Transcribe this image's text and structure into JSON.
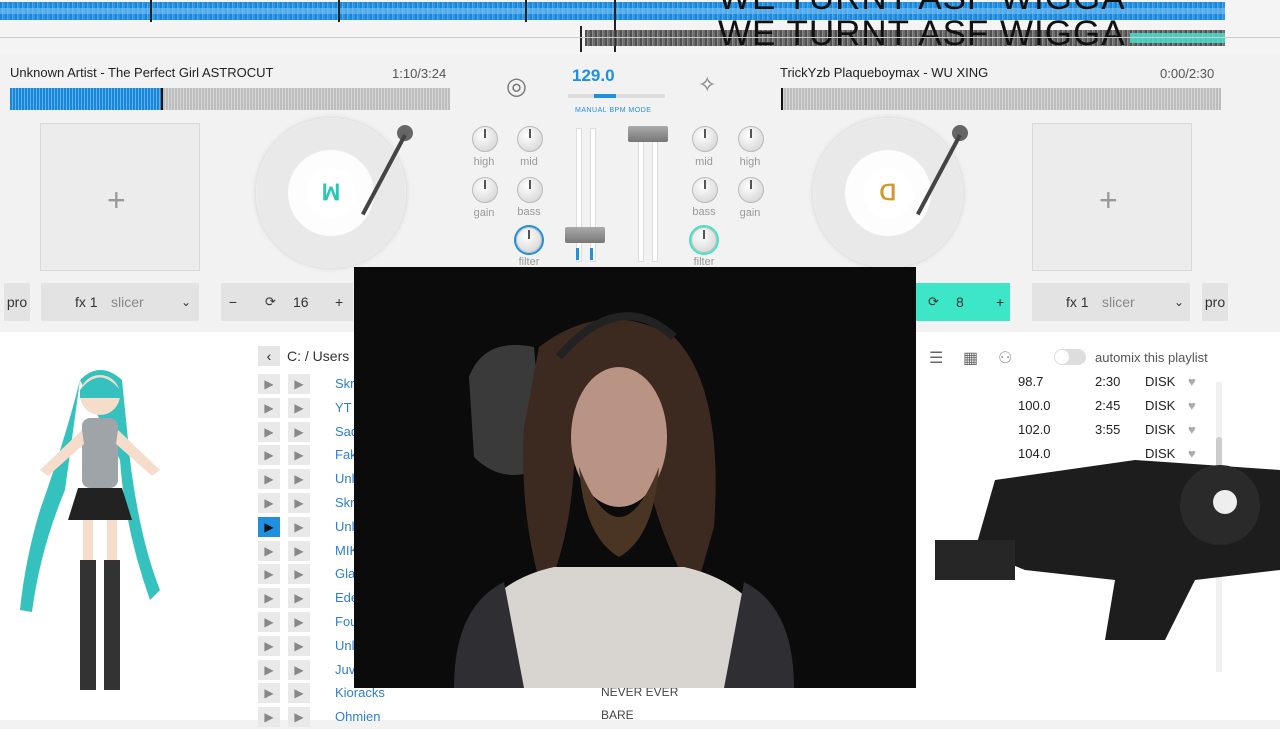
{
  "overview": {
    "overlay_line1": "WE TURNT ASF WIGGA",
    "overlay_line2": "WE TURNT ASF WIGGA"
  },
  "deck_left": {
    "title": "Unknown Artist - The Perfect Girl ASTROCUT",
    "time": "1:10/3:24",
    "pro": "pro",
    "fx": "fx 1",
    "fx_type": "slicer",
    "loop_minus": "−",
    "loop_value": "16",
    "loop_plus": "+"
  },
  "deck_right": {
    "title": "TrickYzb Plaqueboymax - WU XING",
    "time": "0:00/2:30",
    "pro": "pro",
    "fx": "fx 1",
    "fx_type": "slicer",
    "loop_value": "8",
    "loop_plus": "+"
  },
  "mixer": {
    "bpm": "129.0",
    "bpm_mode": "MANUAL BPM MODE",
    "left_knobs": [
      "high",
      "mid",
      "gain",
      "bass",
      "filter"
    ],
    "right_knobs": [
      "mid",
      "high",
      "bass",
      "gain",
      "filter"
    ]
  },
  "library": {
    "path": "C: / Users",
    "automix_label": "automix this playlist",
    "left_artists": [
      "Skr",
      "YT",
      "Sad",
      "Fak",
      "Unl",
      "Skr",
      "Unl",
      "MIK",
      "Gla",
      "Ede",
      "Fou",
      "Unl",
      "Juv",
      "Kioracks",
      "Ohmien"
    ],
    "titles_visible": [
      "NEVER EVER",
      "BARE"
    ],
    "right_rows": [
      {
        "bpm": "98.7",
        "length": "2:30",
        "source": "DISK"
      },
      {
        "bpm": "100.0",
        "length": "2:45",
        "source": "DISK"
      },
      {
        "bpm": "102.0",
        "length": "3:55",
        "source": "DISK"
      },
      {
        "bpm": "104.0",
        "length": "",
        "source": "DISK"
      }
    ]
  },
  "colors": {
    "accent": "#1f8fe0",
    "cyan": "#3ee6c8",
    "link": "#2d7fd0"
  }
}
